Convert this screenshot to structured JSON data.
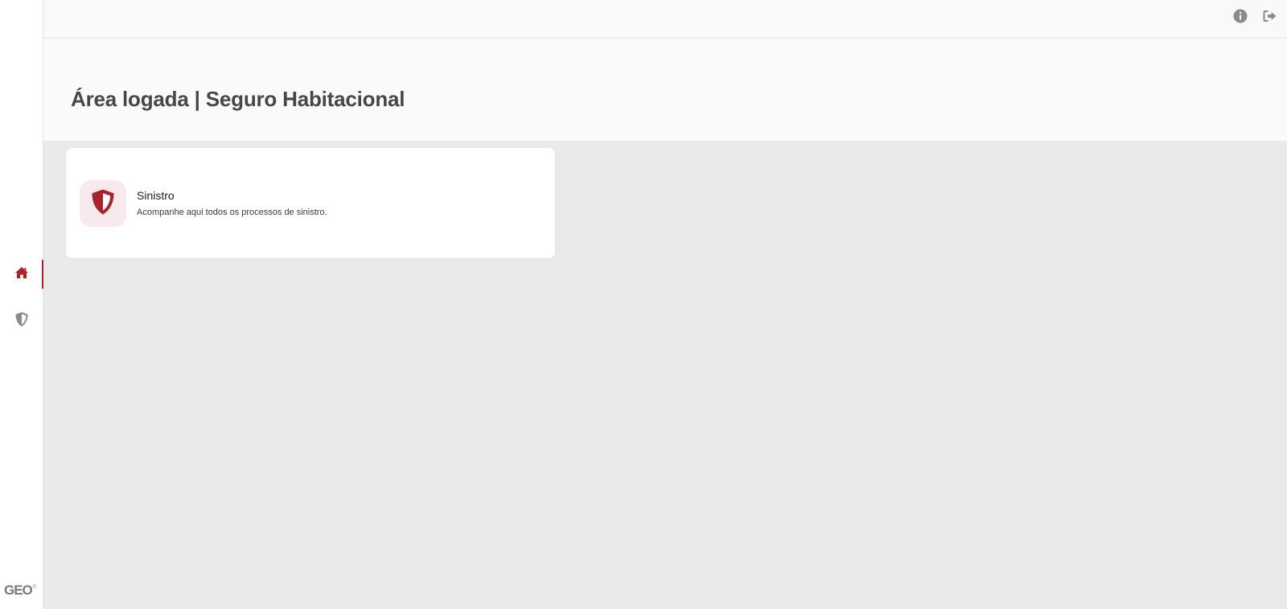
{
  "colors": {
    "accent": "#a9232c",
    "icon_muted": "#8a8a8a",
    "card_icon_bg": "#f7e9ec",
    "title": "#4a4647"
  },
  "sidebar": {
    "items": [
      {
        "name": "home",
        "icon": "home-icon",
        "active": true
      },
      {
        "name": "sinistro",
        "icon": "shield-icon",
        "active": false
      }
    ],
    "logo": {
      "text": "GEO",
      "mark": "©"
    }
  },
  "topbar": {
    "icons": [
      "info-icon",
      "logout-icon"
    ]
  },
  "header": {
    "title": "Área logada | Seguro Habitacional"
  },
  "cards": [
    {
      "icon": "shield-icon",
      "title": "Sinistro",
      "description": "Acompanhe aqui todos os processos de sinistro."
    }
  ]
}
